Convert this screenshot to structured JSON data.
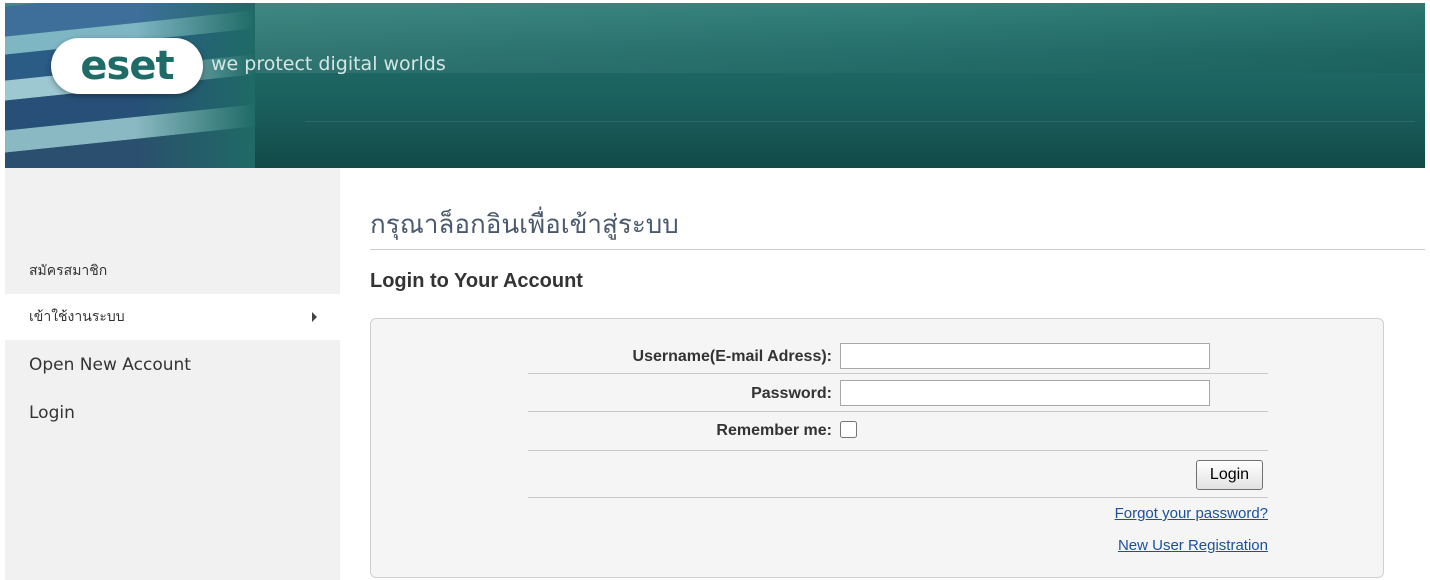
{
  "header": {
    "logo_text": "eset",
    "slogan": "we protect digital worlds"
  },
  "sidebar": {
    "items": [
      {
        "label": "สมัครสมาชิก"
      },
      {
        "label": "เข้าใช้งานระบบ",
        "active": true
      },
      {
        "label": "Open New Account"
      },
      {
        "label": "Login"
      }
    ]
  },
  "main": {
    "page_title": "กรุณาล็อกอินเพื่อเข้าสู่ระบบ",
    "section_title": "Login to Your Account",
    "form": {
      "username_label": "Username(E-mail Adress):",
      "username_value": "",
      "password_label": "Password:",
      "password_value": "",
      "remember_label": "Remember me:",
      "remember_checked": false,
      "login_button": "Login",
      "forgot_link": "Forgot your password?",
      "register_link": "New User Registration"
    }
  },
  "colors": {
    "header_teal": "#1f6a66",
    "sidebar_bg": "#f1f1f1",
    "title_color": "#4a5a6e",
    "link_color": "#1c4f9c",
    "form_bg": "#f5f5f5"
  },
  "icons": {
    "active_item_arrow": "triangle-right-icon"
  }
}
